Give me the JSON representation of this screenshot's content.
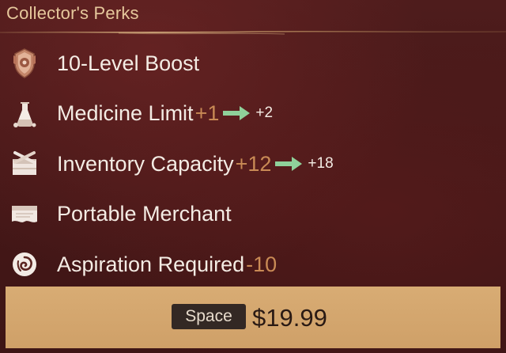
{
  "header": {
    "title": "Collector's Perks"
  },
  "perks": [
    {
      "icon": "boost-emblem-icon",
      "label": "10-Level Boost",
      "modifier": "",
      "next": ""
    },
    {
      "icon": "medicine-flask-icon",
      "label": "Medicine Limit",
      "modifier": "+1",
      "next": "+2"
    },
    {
      "icon": "inventory-crate-icon",
      "label": "Inventory Capacity",
      "modifier": "+12",
      "next": "+18"
    },
    {
      "icon": "merchant-scroll-icon",
      "label": "Portable Merchant",
      "modifier": "",
      "next": ""
    },
    {
      "icon": "aspiration-swirl-icon",
      "label": "Aspiration Required",
      "modifier": "-10",
      "next": ""
    }
  ],
  "purchase": {
    "key_hint": "Space",
    "price": "$19.99"
  },
  "colors": {
    "title": "#e6c89c",
    "modifier": "#c98a55",
    "arrow": "#8fd19a",
    "price_bar": "#d4a66f",
    "key_badge": "#332824"
  }
}
